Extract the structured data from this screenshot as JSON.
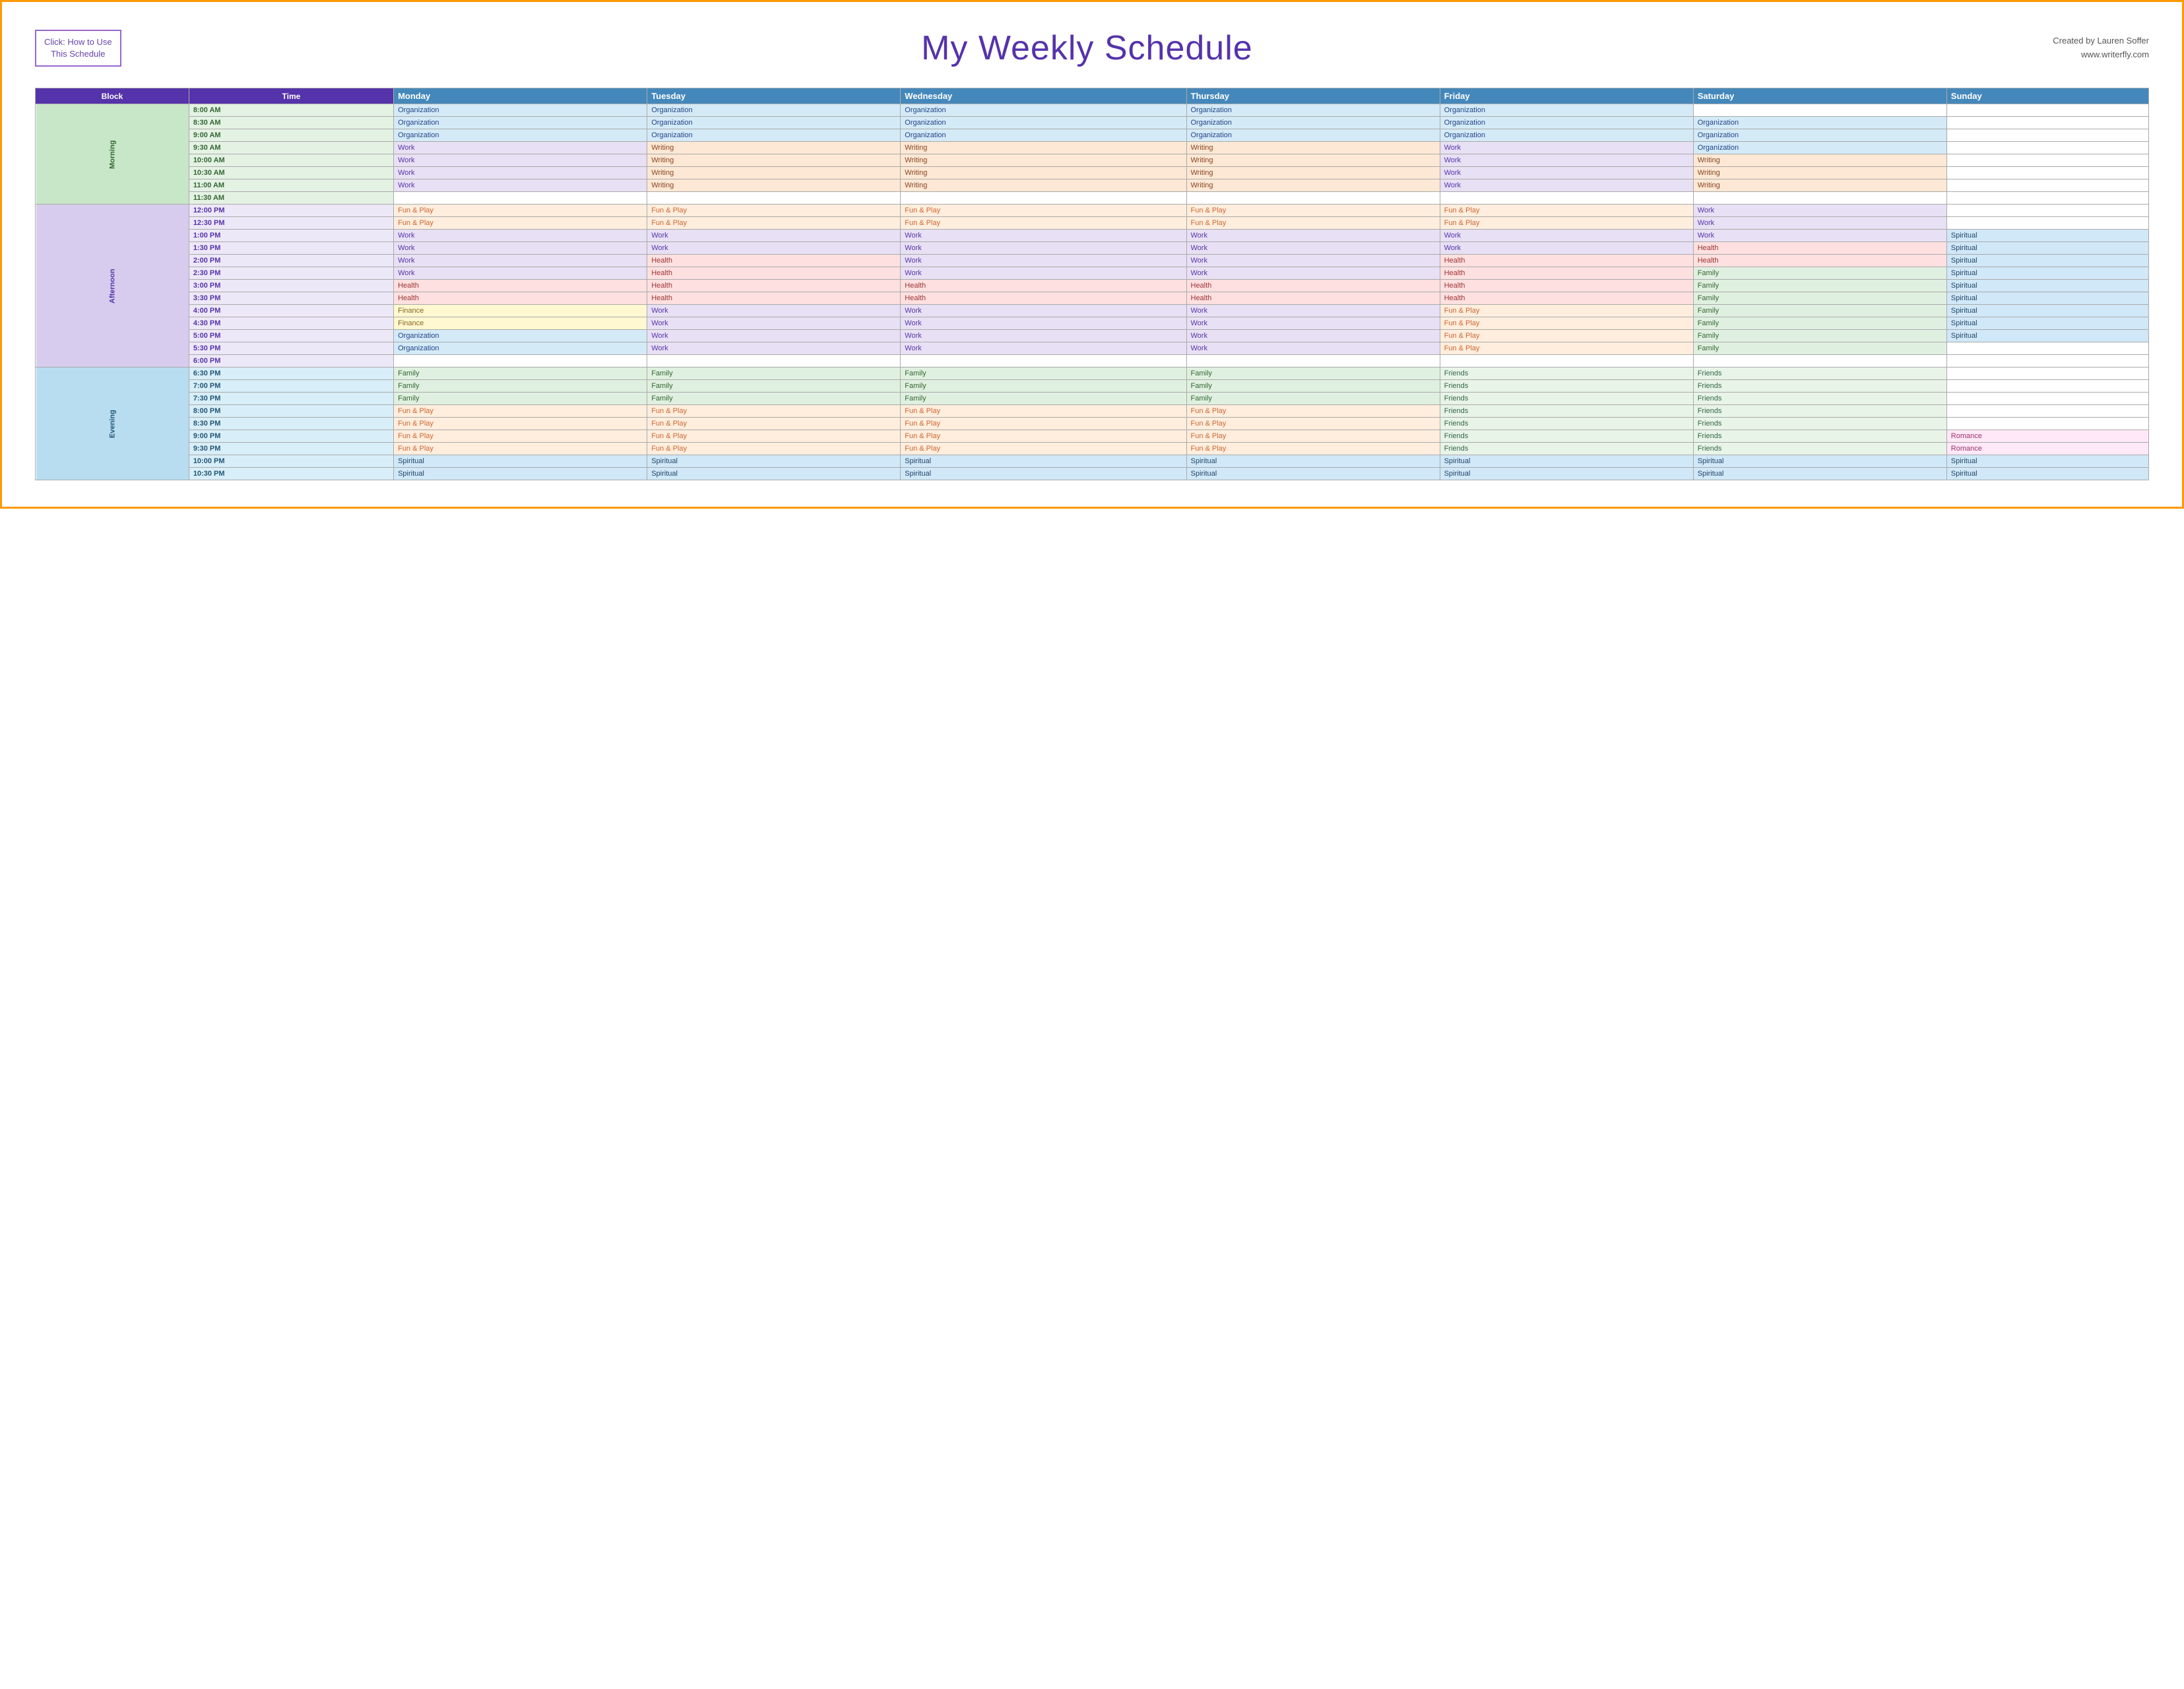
{
  "header": {
    "click_box_line1": "Click:  How to Use",
    "click_box_line2": "This Schedule",
    "title": "My Weekly Schedule",
    "credit_line1": "Created by Lauren Soffer",
    "credit_line2": "www.writerfly.com"
  },
  "table": {
    "headers": [
      "Block",
      "Time",
      "Monday",
      "Tuesday",
      "Wednesday",
      "Thursday",
      "Friday",
      "Saturday",
      "Sunday"
    ],
    "blocks": {
      "morning": "Morning",
      "afternoon": "Afternoon",
      "evening": "Evening"
    },
    "rows": [
      {
        "block": "morning",
        "time": "8:00 AM",
        "mon": "Organization",
        "tue": "Organization",
        "wed": "Organization",
        "thu": "Organization",
        "fri": "Organization",
        "sat": "",
        "sun": ""
      },
      {
        "block": "morning",
        "time": "8:30 AM",
        "mon": "Organization",
        "tue": "Organization",
        "wed": "Organization",
        "thu": "Organization",
        "fri": "Organization",
        "sat": "Organization",
        "sun": ""
      },
      {
        "block": "morning",
        "time": "9:00 AM",
        "mon": "Organization",
        "tue": "Organization",
        "wed": "Organization",
        "thu": "Organization",
        "fri": "Organization",
        "sat": "Organization",
        "sun": ""
      },
      {
        "block": "morning",
        "time": "9:30 AM",
        "mon": "Work",
        "tue": "Writing",
        "wed": "Writing",
        "thu": "Writing",
        "fri": "Work",
        "sat": "Organization",
        "sun": ""
      },
      {
        "block": "morning",
        "time": "10:00 AM",
        "mon": "Work",
        "tue": "Writing",
        "wed": "Writing",
        "thu": "Writing",
        "fri": "Work",
        "sat": "Writing",
        "sun": ""
      },
      {
        "block": "morning",
        "time": "10:30 AM",
        "mon": "Work",
        "tue": "Writing",
        "wed": "Writing",
        "thu": "Writing",
        "fri": "Work",
        "sat": "Writing",
        "sun": ""
      },
      {
        "block": "morning",
        "time": "11:00 AM",
        "mon": "Work",
        "tue": "Writing",
        "wed": "Writing",
        "thu": "Writing",
        "fri": "Work",
        "sat": "Writing",
        "sun": ""
      },
      {
        "block": "morning",
        "time": "11:30 AM",
        "mon": "",
        "tue": "",
        "wed": "",
        "thu": "",
        "fri": "",
        "sat": "",
        "sun": ""
      },
      {
        "block": "afternoon",
        "time": "12:00 PM",
        "mon": "Fun & Play",
        "tue": "Fun & Play",
        "wed": "Fun & Play",
        "thu": "Fun & Play",
        "fri": "Fun & Play",
        "sat": "Work",
        "sun": ""
      },
      {
        "block": "afternoon",
        "time": "12:30 PM",
        "mon": "Fun & Play",
        "tue": "Fun & Play",
        "wed": "Fun & Play",
        "thu": "Fun & Play",
        "fri": "Fun & Play",
        "sat": "Work",
        "sun": ""
      },
      {
        "block": "afternoon",
        "time": "1:00 PM",
        "mon": "Work",
        "tue": "Work",
        "wed": "Work",
        "thu": "Work",
        "fri": "Work",
        "sat": "Work",
        "sun": "Spiritual"
      },
      {
        "block": "afternoon",
        "time": "1:30 PM",
        "mon": "Work",
        "tue": "Work",
        "wed": "Work",
        "thu": "Work",
        "fri": "Work",
        "sat": "Health",
        "sun": "Spiritual"
      },
      {
        "block": "afternoon",
        "time": "2:00 PM",
        "mon": "Work",
        "tue": "Health",
        "wed": "Work",
        "thu": "Work",
        "fri": "Health",
        "sat": "Health",
        "sun": "Spiritual"
      },
      {
        "block": "afternoon",
        "time": "2:30 PM",
        "mon": "Work",
        "tue": "Health",
        "wed": "Work",
        "thu": "Work",
        "fri": "Health",
        "sat": "Family",
        "sun": "Spiritual"
      },
      {
        "block": "afternoon",
        "time": "3:00 PM",
        "mon": "Health",
        "tue": "Health",
        "wed": "Health",
        "thu": "Health",
        "fri": "Health",
        "sat": "Family",
        "sun": "Spiritual"
      },
      {
        "block": "afternoon",
        "time": "3:30 PM",
        "mon": "Health",
        "tue": "Health",
        "wed": "Health",
        "thu": "Health",
        "fri": "Health",
        "sat": "Family",
        "sun": "Spiritual"
      },
      {
        "block": "afternoon",
        "time": "4:00 PM",
        "mon": "Finance",
        "tue": "Work",
        "wed": "Work",
        "thu": "Work",
        "fri": "Fun & Play",
        "sat": "Family",
        "sun": "Spiritual"
      },
      {
        "block": "afternoon",
        "time": "4:30 PM",
        "mon": "Finance",
        "tue": "Work",
        "wed": "Work",
        "thu": "Work",
        "fri": "Fun & Play",
        "sat": "Family",
        "sun": "Spiritual"
      },
      {
        "block": "afternoon",
        "time": "5:00 PM",
        "mon": "Organization",
        "tue": "Work",
        "wed": "Work",
        "thu": "Work",
        "fri": "Fun & Play",
        "sat": "Family",
        "sun": "Spiritual"
      },
      {
        "block": "afternoon",
        "time": "5:30 PM",
        "mon": "Organization",
        "tue": "Work",
        "wed": "Work",
        "thu": "Work",
        "fri": "Fun & Play",
        "sat": "Family",
        "sun": ""
      },
      {
        "block": "afternoon",
        "time": "6:00 PM",
        "mon": "",
        "tue": "",
        "wed": "",
        "thu": "",
        "fri": "",
        "sat": "",
        "sun": ""
      },
      {
        "block": "evening",
        "time": "6:30 PM",
        "mon": "Family",
        "tue": "Family",
        "wed": "Family",
        "thu": "Family",
        "fri": "Friends",
        "sat": "Friends",
        "sun": ""
      },
      {
        "block": "evening",
        "time": "7:00 PM",
        "mon": "Family",
        "tue": "Family",
        "wed": "Family",
        "thu": "Family",
        "fri": "Friends",
        "sat": "Friends",
        "sun": ""
      },
      {
        "block": "evening",
        "time": "7:30 PM",
        "mon": "Family",
        "tue": "Family",
        "wed": "Family",
        "thu": "Family",
        "fri": "Friends",
        "sat": "Friends",
        "sun": ""
      },
      {
        "block": "evening",
        "time": "8:00 PM",
        "mon": "Fun & Play",
        "tue": "Fun & Play",
        "wed": "Fun & Play",
        "thu": "Fun & Play",
        "fri": "Friends",
        "sat": "Friends",
        "sun": ""
      },
      {
        "block": "evening",
        "time": "8:30 PM",
        "mon": "Fun & Play",
        "tue": "Fun & Play",
        "wed": "Fun & Play",
        "thu": "Fun & Play",
        "fri": "Friends",
        "sat": "Friends",
        "sun": ""
      },
      {
        "block": "evening",
        "time": "9:00 PM",
        "mon": "Fun & Play",
        "tue": "Fun & Play",
        "wed": "Fun & Play",
        "thu": "Fun & Play",
        "fri": "Friends",
        "sat": "Friends",
        "sun": "Romance"
      },
      {
        "block": "evening",
        "time": "9:30 PM",
        "mon": "Fun & Play",
        "tue": "Fun & Play",
        "wed": "Fun & Play",
        "thu": "Fun & Play",
        "fri": "Friends",
        "sat": "Friends",
        "sun": "Romance"
      },
      {
        "block": "evening",
        "time": "10:00 PM",
        "mon": "Spiritual",
        "tue": "Spiritual",
        "wed": "Spiritual",
        "thu": "Spiritual",
        "fri": "Spiritual",
        "sat": "Spiritual",
        "sun": "Spiritual"
      },
      {
        "block": "evening",
        "time": "10:30 PM",
        "mon": "Spiritual",
        "tue": "Spiritual",
        "wed": "Spiritual",
        "thu": "Spiritual",
        "fri": "Spiritual",
        "sat": "Spiritual",
        "sun": "Spiritual"
      }
    ]
  }
}
